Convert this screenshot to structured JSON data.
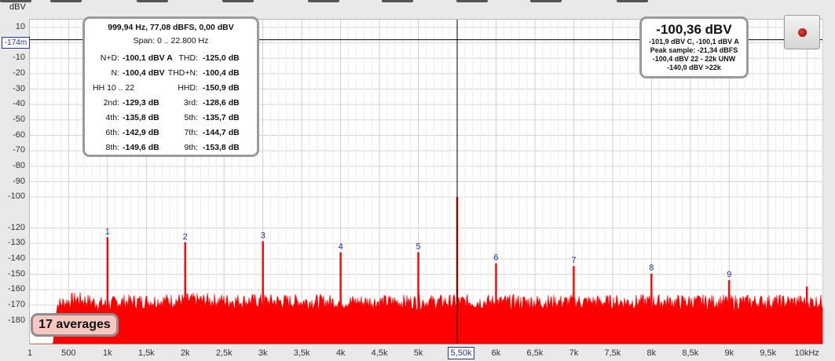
{
  "y_unit": "dBV",
  "cursor": {
    "y_readout": "-174m",
    "x_readout": "5,50k"
  },
  "stats_box": {
    "header": "999,94 Hz, 77,08 dBFS, 0,00 dBV",
    "span": "Span: 0 .. 22.800 Hz",
    "rows": [
      {
        "l_label": "N+D:",
        "l_value": "-100,1 dBV A",
        "r_label": "THD:",
        "r_value": "-125,0 dB"
      },
      {
        "l_label": "N:",
        "l_value": "-100,4 dBV",
        "r_label": "THD+N:",
        "r_value": "-100,4 dB"
      },
      {
        "l_label": "HH 10 .. 22",
        "l_value": "",
        "r_label": "HHD:",
        "r_value": "-150,9 dB"
      },
      {
        "l_label": "2nd:",
        "l_value": "-129,3 dB",
        "r_label": "3rd:",
        "r_value": "-128,6 dB"
      },
      {
        "l_label": "4th:",
        "l_value": "-135,8 dB",
        "r_label": "5th:",
        "r_value": "-135,7 dB"
      },
      {
        "l_label": "6th:",
        "l_value": "-142,9 dB",
        "r_label": "7th:",
        "r_value": "-144,7 dB"
      },
      {
        "l_label": "8th:",
        "l_value": "-149,6 dB",
        "r_label": "9th:",
        "r_value": "-153,8 dB"
      }
    ]
  },
  "level_box": {
    "main": "-100,36 dBV",
    "lines": [
      "-101,9 dBV C, -100,1 dBV A",
      "Peak sample: -21,34 dBFS",
      "-100,4 dBV 22 - 22k UNW",
      "-140,0 dBV >22k"
    ]
  },
  "averages_badge": "17 averages",
  "colors": {
    "trace": "#ff0000",
    "harmonic_label": "#1a2fb0",
    "cursor": "#000000",
    "grid": "#d6d6d6"
  },
  "icons": {
    "record_button": "record-dot-icon"
  },
  "chart_data": {
    "type": "area",
    "x_scale": "linear",
    "xlim": [
      1,
      10200
    ],
    "ylim": [
      -195,
      15
    ],
    "yticks": [
      10,
      0,
      -10,
      -20,
      -30,
      -40,
      -50,
      -60,
      -70,
      -80,
      -90,
      -100,
      -120,
      -130,
      -140,
      -150,
      -160,
      -170,
      -180
    ],
    "xticks": [
      {
        "v": 1,
        "label": "1"
      },
      {
        "v": 500,
        "label": "500"
      },
      {
        "v": 1000,
        "label": "1k"
      },
      {
        "v": 1500,
        "label": "1,5k"
      },
      {
        "v": 2000,
        "label": "2k"
      },
      {
        "v": 2500,
        "label": "2,5k"
      },
      {
        "v": 3000,
        "label": "3k"
      },
      {
        "v": 3500,
        "label": "3,5k"
      },
      {
        "v": 4000,
        "label": "4k"
      },
      {
        "v": 4500,
        "label": "4,5k"
      },
      {
        "v": 5000,
        "label": "5k"
      },
      {
        "v": 6000,
        "label": "6k"
      },
      {
        "v": 6500,
        "label": "6,5k"
      },
      {
        "v": 7000,
        "label": "7k"
      },
      {
        "v": 7500,
        "label": "7,5k"
      },
      {
        "v": 8000,
        "label": "8k"
      },
      {
        "v": 8500,
        "label": "8,5k"
      },
      {
        "v": 9000,
        "label": "9k"
      },
      {
        "v": 9500,
        "label": "9,5k"
      },
      {
        "v": 10000,
        "label": "10kHz"
      }
    ],
    "cursor": {
      "x": 5500,
      "y": 2
    },
    "noise_floor": [
      {
        "x": 1,
        "y": -196
      },
      {
        "x": 300,
        "y": -196
      },
      {
        "x": 350,
        "y": -172
      },
      {
        "x": 600,
        "y": -168
      },
      {
        "x": 1000,
        "y": -172
      },
      {
        "x": 1150,
        "y": -170
      },
      {
        "x": 2000,
        "y": -169
      },
      {
        "x": 4000,
        "y": -170
      },
      {
        "x": 6000,
        "y": -170
      },
      {
        "x": 8000,
        "y": -170
      },
      {
        "x": 10200,
        "y": -170
      }
    ],
    "peaks": [
      {
        "x": 1000,
        "y": -126,
        "label": "1"
      },
      {
        "x": 2000,
        "y": -129.3,
        "label": "2"
      },
      {
        "x": 3000,
        "y": -128.6,
        "label": "3"
      },
      {
        "x": 4000,
        "y": -135.8,
        "label": "4"
      },
      {
        "x": 5000,
        "y": -135.7,
        "label": "5"
      },
      {
        "x": 5500,
        "y": -100,
        "label": ""
      },
      {
        "x": 6000,
        "y": -142.9,
        "label": "6"
      },
      {
        "x": 7000,
        "y": -144.7,
        "label": "7"
      },
      {
        "x": 8000,
        "y": -149.6,
        "label": "8"
      },
      {
        "x": 9000,
        "y": -153.8,
        "label": "9"
      },
      {
        "x": 10000,
        "y": -158,
        "label": ""
      }
    ]
  }
}
